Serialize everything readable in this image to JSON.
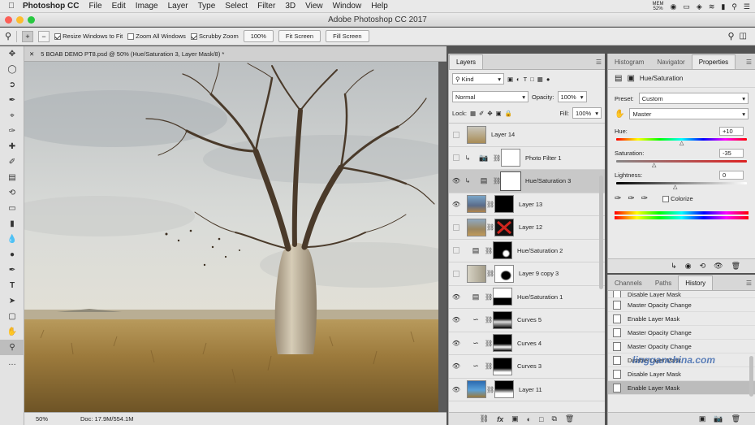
{
  "menubar": {
    "app": "Photoshop CC",
    "items": [
      "File",
      "Edit",
      "Image",
      "Layer",
      "Type",
      "Select",
      "Filter",
      "3D",
      "View",
      "Window",
      "Help"
    ],
    "mem": "MEM",
    "mem_pct": "52%"
  },
  "window": {
    "title": "Adobe Photoshop CC 2017"
  },
  "options": {
    "resize": "Resize Windows to Fit",
    "zoom_all": "Zoom All Windows",
    "scrubby": "Scrubby Zoom",
    "zoom_value": "100%",
    "fit_screen": "Fit Screen",
    "fill_screen": "Fill Screen"
  },
  "doc": {
    "tab": "5 BOAB DEMO PT8.psd @ 50% (Hue/Saturation 3, Layer Mask/8) *",
    "zoom": "50%",
    "info": "Doc: 17.9M/554.1M"
  },
  "layers": {
    "tab": "Layers",
    "kind": "Kind",
    "blend": "Normal",
    "opacity_label": "Opacity:",
    "opacity": "100%",
    "lock_label": "Lock:",
    "fill_label": "Fill:",
    "fill": "100%",
    "items": [
      {
        "name": "Layer 14",
        "eye": false,
        "type": "photo"
      },
      {
        "name": "Photo Filter 1",
        "eye": false,
        "type": "adj"
      },
      {
        "name": "Hue/Saturation 3",
        "eye": true,
        "type": "adj",
        "selected": true
      },
      {
        "name": "Layer 13",
        "eye": true,
        "type": "photo"
      },
      {
        "name": "Layer 12",
        "eye": false,
        "type": "photo"
      },
      {
        "name": "Hue/Saturation 2",
        "eye": false,
        "type": "adj"
      },
      {
        "name": "Layer 9 copy 3",
        "eye": false,
        "type": "photo"
      },
      {
        "name": "Hue/Saturation 1",
        "eye": true,
        "type": "adj"
      },
      {
        "name": "Curves 5",
        "eye": true,
        "type": "curve"
      },
      {
        "name": "Curves 4",
        "eye": true,
        "type": "curve"
      },
      {
        "name": "Curves 3",
        "eye": true,
        "type": "curve"
      },
      {
        "name": "Layer 11",
        "eye": true,
        "type": "photo"
      }
    ]
  },
  "props": {
    "tabs": [
      "Histogram",
      "Navigator",
      "Properties"
    ],
    "title": "Hue/Saturation",
    "preset_label": "Preset:",
    "preset": "Custom",
    "channel": "Master",
    "hue_label": "Hue:",
    "hue": "+10",
    "sat_label": "Saturation:",
    "sat": "-35",
    "light_label": "Lightness:",
    "light": "0",
    "colorize": "Colorize"
  },
  "history": {
    "tabs": [
      "Channels",
      "Paths",
      "History"
    ],
    "items": [
      "Disable Layer Mask",
      "Master Opacity Change",
      "Enable Layer Mask",
      "Master Opacity Change",
      "Master Opacity Change",
      "Disable Layer Mask",
      "Disable Layer Mask",
      "Enable Layer Mask"
    ],
    "watermark": "lingganchina.com"
  }
}
